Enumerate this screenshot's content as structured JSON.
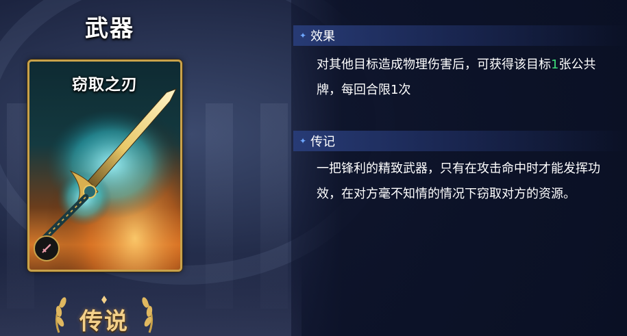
{
  "category": "武器",
  "card": {
    "name": "窃取之刃",
    "badge_icon": "sword-icon"
  },
  "rarity": "传说",
  "effect": {
    "title": "效果",
    "text_before": "对其他目标造成物理伤害后，可获得该目标",
    "highlight": "1",
    "text_after": "张公共牌，每回合限1次",
    "highlight_color": "#3ee07a"
  },
  "lore": {
    "title": "传记",
    "text": "一把锋利的精致武器，只有在攻击命中时才能发挥功效，在对方毫不知情的情况下窃取对方的资源。"
  },
  "colors": {
    "accent_blue": "#6fa8ff",
    "gold": "#c9a24a"
  }
}
